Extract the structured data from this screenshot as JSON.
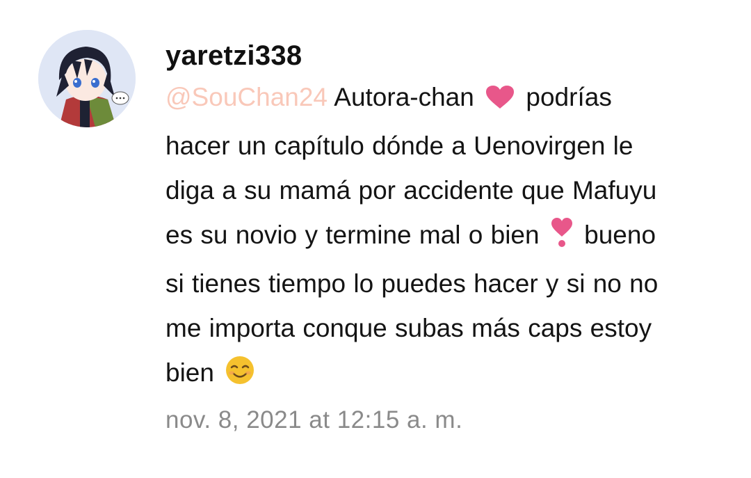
{
  "comment": {
    "username": "yaretzi338",
    "mention": "@SouChan24",
    "text_segments": [
      "Autora-chan",
      "podrías",
      "hacer un capítulo dónde a Uenovirgen le",
      "diga a su mamá por accidente que Mafuyu",
      "es su novio y termine mal o bien",
      "bueno",
      "si tienes tiempo lo puedes hacer y si no no",
      "me importa conque subas más caps estoy",
      "bien"
    ],
    "emojis": [
      "heart-icon",
      "heart-exclamation-icon",
      "smiling-face-icon"
    ],
    "timestamp": "nov. 8, 2021 at 12:15 a. m."
  },
  "colors": {
    "mention": "#f9c8b9",
    "username": "#111111",
    "body": "#141414",
    "timestamp": "#8a8a8a",
    "heart": "#e8578a"
  }
}
